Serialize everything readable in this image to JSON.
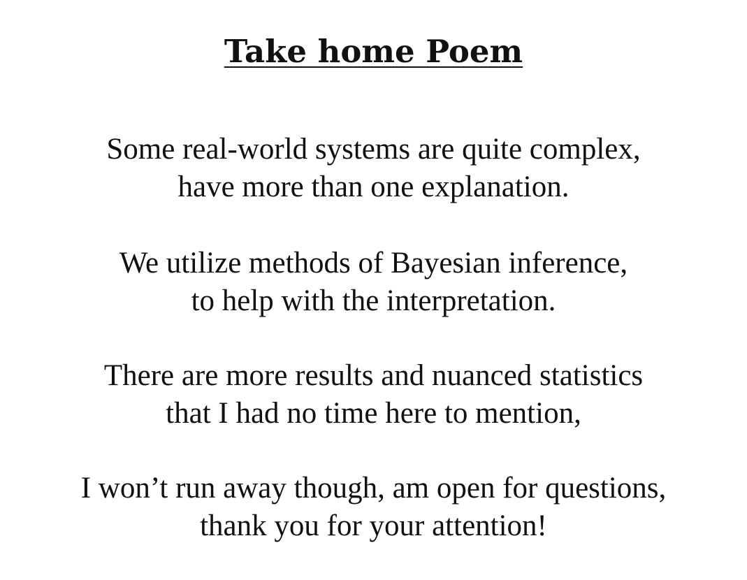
{
  "title": "Take home Poem",
  "stanzas": [
    {
      "lines": [
        "Some real-world systems are quite complex,",
        "have more than one explanation."
      ]
    },
    {
      "lines": [
        "We utilize methods of Bayesian inference,",
        "to help with the interpretation."
      ]
    },
    {
      "lines": [
        "There are more results and nuanced statistics",
        "that I had no time here to mention,"
      ]
    },
    {
      "lines": [
        "I won’t run away though, am open for questions,",
        "thank you for your attention!"
      ]
    }
  ]
}
